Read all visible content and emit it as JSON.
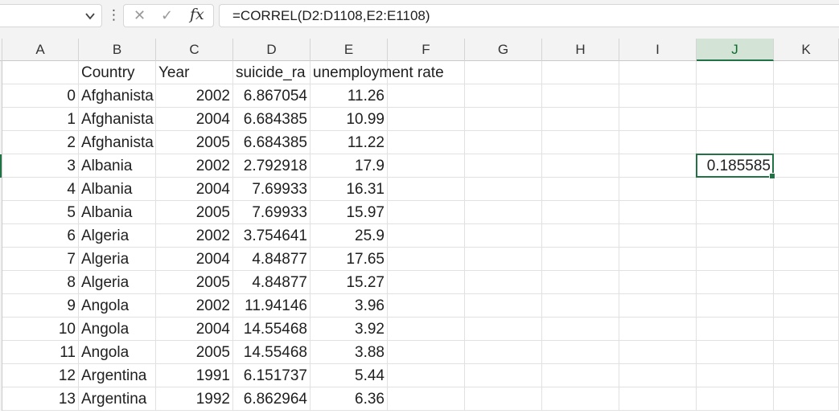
{
  "formula_bar": {
    "name_box_value": "",
    "chevron_icon": "chevron-down-icon",
    "separator": "⋮",
    "cancel_icon": "✕",
    "enter_icon": "✓",
    "fx_label": "fx",
    "formula": "=CORREL(D2:D1108,E2:E1108)"
  },
  "columns": [
    "A",
    "B",
    "C",
    "D",
    "E",
    "F",
    "G",
    "H",
    "I",
    "J",
    "K"
  ],
  "selected_column": "J",
  "header_row": {
    "B": "Country",
    "C": "Year",
    "D": "suicide_ra",
    "E": "unemployment rate"
  },
  "rows": [
    {
      "A": "0",
      "B": "Afghanista",
      "C": "2002",
      "D": "6.867054",
      "E": "11.26"
    },
    {
      "A": "1",
      "B": "Afghanista",
      "C": "2004",
      "D": "6.684385",
      "E": "10.99"
    },
    {
      "A": "2",
      "B": "Afghanista",
      "C": "2005",
      "D": "6.684385",
      "E": "11.22"
    },
    {
      "A": "3",
      "B": "Albania",
      "C": "2002",
      "D": "2.792918",
      "E": "17.9"
    },
    {
      "A": "4",
      "B": "Albania",
      "C": "2004",
      "D": "7.69933",
      "E": "16.31"
    },
    {
      "A": "5",
      "B": "Albania",
      "C": "2005",
      "D": "7.69933",
      "E": "15.97"
    },
    {
      "A": "6",
      "B": "Algeria",
      "C": "2002",
      "D": "3.754641",
      "E": "25.9"
    },
    {
      "A": "7",
      "B": "Algeria",
      "C": "2004",
      "D": "4.84877",
      "E": "17.65"
    },
    {
      "A": "8",
      "B": "Algeria",
      "C": "2005",
      "D": "4.84877",
      "E": "15.27"
    },
    {
      "A": "9",
      "B": "Angola",
      "C": "2002",
      "D": "11.94146",
      "E": "3.96"
    },
    {
      "A": "10",
      "B": "Angola",
      "C": "2004",
      "D": "14.55468",
      "E": "3.92"
    },
    {
      "A": "11",
      "B": "Angola",
      "C": "2005",
      "D": "14.55468",
      "E": "3.88"
    },
    {
      "A": "12",
      "B": "Argentina",
      "C": "1991",
      "D": "6.151737",
      "E": "5.44"
    },
    {
      "A": "13",
      "B": "Argentina",
      "C": "1992",
      "D": "6.862964",
      "E": "6.36"
    }
  ],
  "result_cell": {
    "column": "J",
    "row_index": 4,
    "value": "0.185585"
  },
  "colors": {
    "accent": "#217346",
    "selected_header_bg": "#d3e3d6",
    "gridline": "#e1e1e1"
  }
}
